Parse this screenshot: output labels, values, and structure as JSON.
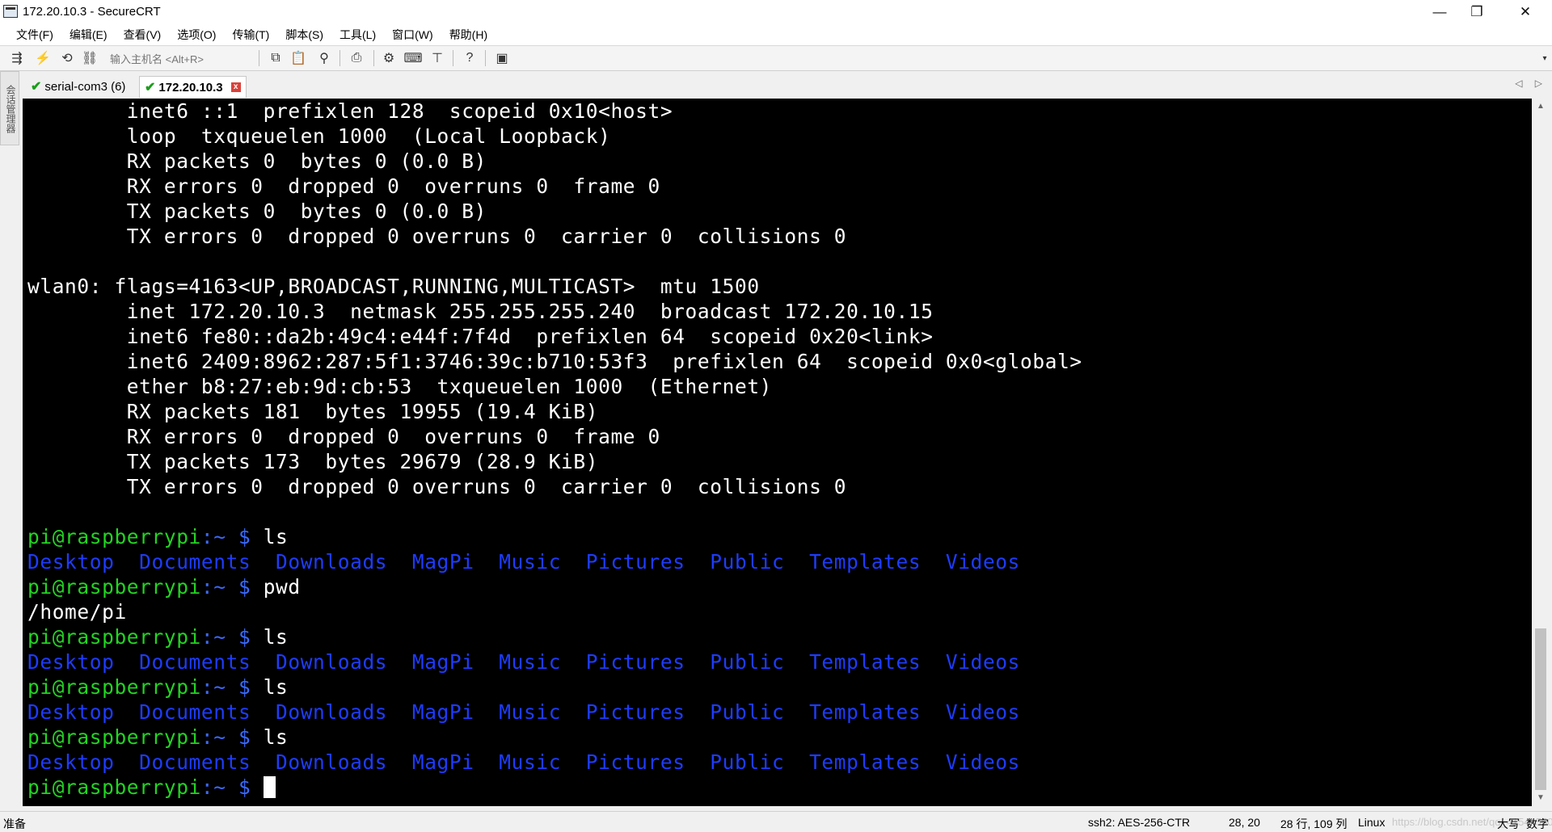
{
  "window": {
    "title": "172.20.10.3 - SecureCRT",
    "minimize": "—",
    "restore": "❐",
    "close": "✕"
  },
  "menu": [
    "文件(F)",
    "编辑(E)",
    "查看(V)",
    "选项(O)",
    "传输(T)",
    "脚本(S)",
    "工具(L)",
    "窗口(W)",
    "帮助(H)"
  ],
  "toolbar": {
    "host_placeholder": "输入主机名 <Alt+R>"
  },
  "sidepanel": {
    "label": "会话管理器"
  },
  "tabs": [
    {
      "label": "serial-com3 (6)",
      "active": false
    },
    {
      "label": "172.20.10.3",
      "active": true
    }
  ],
  "terminal": {
    "output_lines": [
      "        inet6 ::1  prefixlen 128  scopeid 0x10<host>",
      "        loop  txqueuelen 1000  (Local Loopback)",
      "        RX packets 0  bytes 0 (0.0 B)",
      "        RX errors 0  dropped 0  overruns 0  frame 0",
      "        TX packets 0  bytes 0 (0.0 B)",
      "        TX errors 0  dropped 0 overruns 0  carrier 0  collisions 0",
      "",
      "wlan0: flags=4163<UP,BROADCAST,RUNNING,MULTICAST>  mtu 1500",
      "        inet 172.20.10.3  netmask 255.255.255.240  broadcast 172.20.10.15",
      "        inet6 fe80::da2b:49c4:e44f:7f4d  prefixlen 64  scopeid 0x20<link>",
      "        inet6 2409:8962:287:5f1:3746:39c:b710:53f3  prefixlen 64  scopeid 0x0<global>",
      "        ether b8:27:eb:9d:cb:53  txqueuelen 1000  (Ethernet)",
      "        RX packets 181  bytes 19955 (19.4 KiB)",
      "        RX errors 0  dropped 0  overruns 0  frame 0",
      "        TX packets 173  bytes 29679 (28.9 KiB)",
      "        TX errors 0  dropped 0 overruns 0  carrier 0  collisions 0",
      ""
    ],
    "prompt_user": "pi@raspberrypi",
    "prompt_sep": ":",
    "prompt_path": "~",
    "prompt_sym": " $ ",
    "dir_listing": "Desktop  Documents  Downloads  MagPi  Music  Pictures  Public  Templates  Videos",
    "commands": [
      "ls",
      "pwd",
      "ls",
      "ls",
      "ls"
    ],
    "pwd_output": "/home/pi"
  },
  "status": {
    "left": "准备",
    "cipher": "ssh2: AES-256-CTR",
    "cursor_pos": "28,  20",
    "dims": "28 行, 109 列",
    "os": "Linux",
    "watermark": "https://blog.csdn.net/qq_41544550",
    "caps": "大写",
    "num": "数字"
  }
}
